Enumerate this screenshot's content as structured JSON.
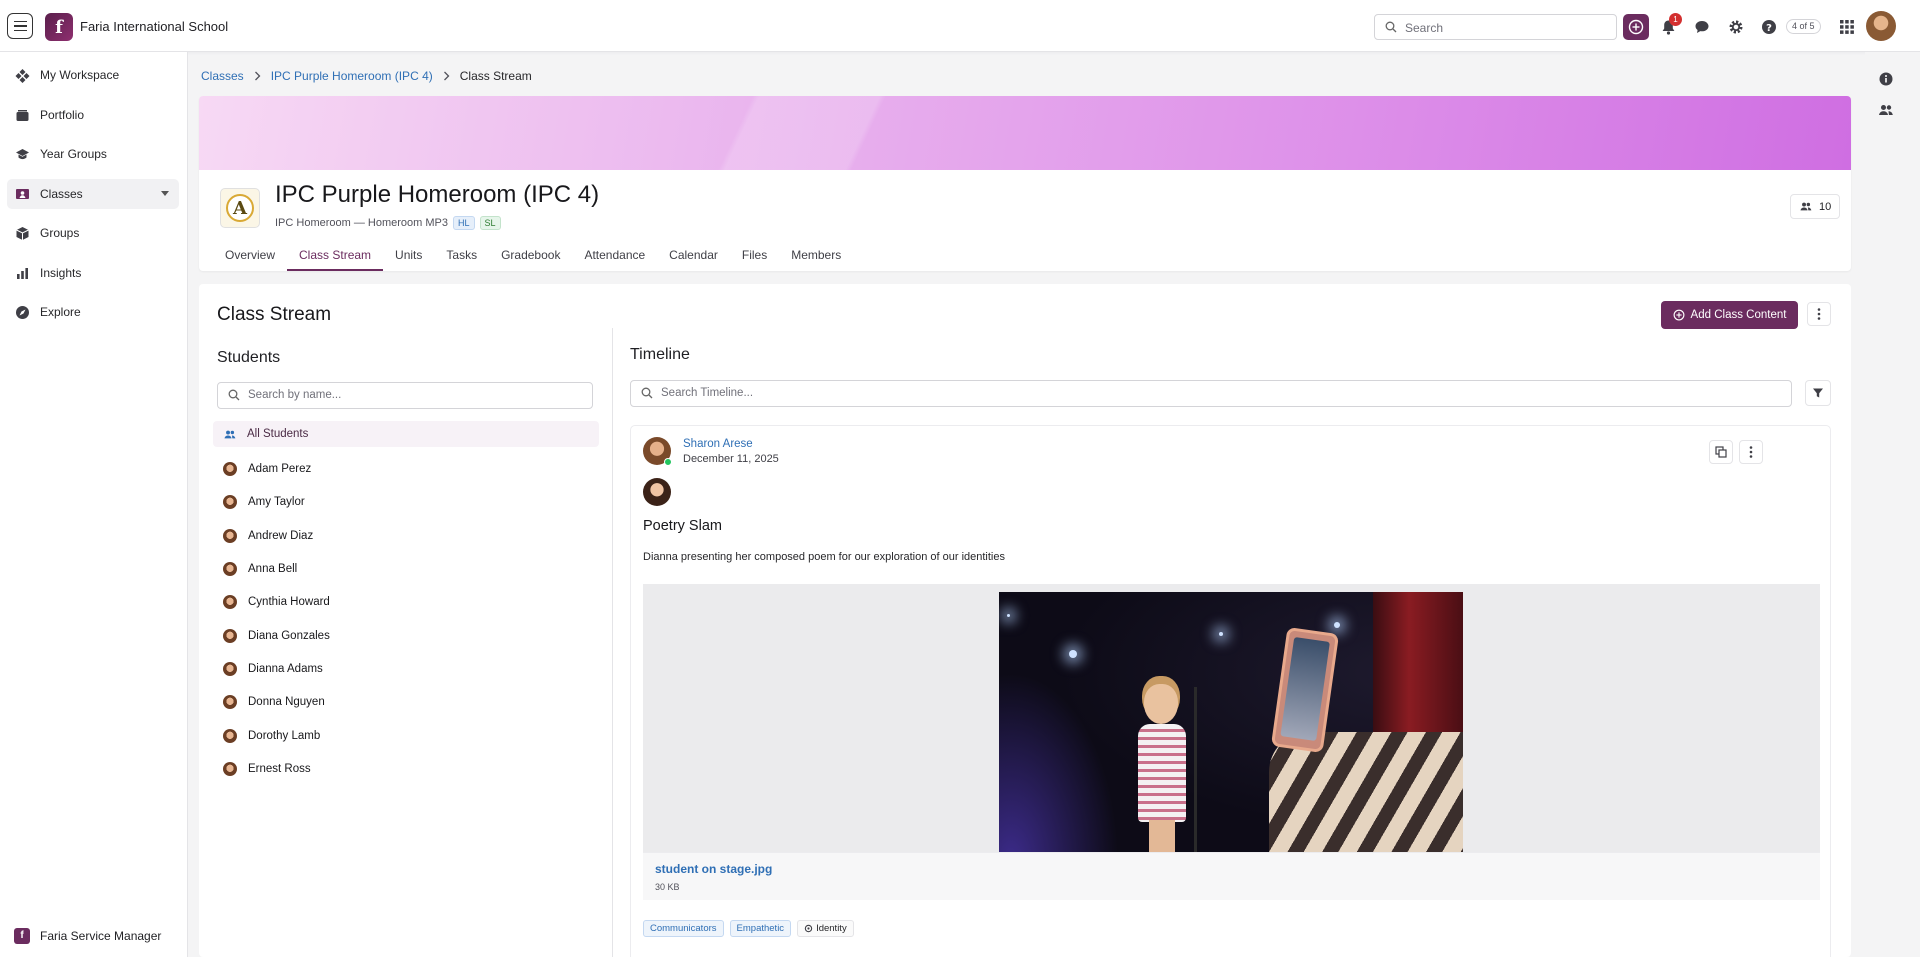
{
  "topbar": {
    "app_name": "Faria International School",
    "logo_letter": "f",
    "search_placeholder": "Search",
    "notification_count": "1",
    "pager": "4 of 5"
  },
  "sidebar": {
    "items": [
      {
        "label": "My Workspace",
        "icon": "workspace-icon"
      },
      {
        "label": "Portfolio",
        "icon": "portfolio-icon"
      },
      {
        "label": "Year Groups",
        "icon": "year-groups-icon"
      },
      {
        "label": "Classes",
        "icon": "classes-icon"
      },
      {
        "label": "Groups",
        "icon": "groups-icon"
      },
      {
        "label": "Insights",
        "icon": "insights-icon"
      },
      {
        "label": "Explore",
        "icon": "explore-icon"
      }
    ],
    "footer_label": "Faria Service Manager"
  },
  "breadcrumb": [
    "Classes",
    "IPC Purple Homeroom (IPC 4)",
    "Class Stream"
  ],
  "class_header": {
    "icon_letter": "A",
    "title": "IPC Purple Homeroom (IPC 4)",
    "subtitle": "IPC Homeroom — Homeroom MP3",
    "tags": [
      "HL",
      "SL"
    ],
    "member_count": "10",
    "tabs": [
      "Overview",
      "Class Stream",
      "Units",
      "Tasks",
      "Gradebook",
      "Attendance",
      "Calendar",
      "Files",
      "Members"
    ],
    "active_tab": "Class Stream"
  },
  "stream": {
    "title": "Class Stream",
    "add_button": "Add Class Content",
    "students_heading": "Students",
    "students_search_placeholder": "Search by name...",
    "all_students_label": "All Students",
    "students": [
      "Adam Perez",
      "Amy Taylor",
      "Andrew Diaz",
      "Anna Bell",
      "Cynthia Howard",
      "Diana Gonzales",
      "Dianna Adams",
      "Donna Nguyen",
      "Dorothy Lamb",
      "Ernest Ross"
    ],
    "timeline_heading": "Timeline",
    "timeline_search_placeholder": "Search Timeline..."
  },
  "post": {
    "author": "Sharon Arese",
    "date": "December 11, 2025",
    "title": "Poetry Slam",
    "description": "Dianna presenting her composed poem for our exploration of our identities",
    "file_name": "student on stage.jpg",
    "file_size": "30 KB",
    "tags": [
      "Communicators",
      "Empathetic"
    ],
    "concept_tag": "Identity"
  },
  "colors": {
    "brand": "#6b2c5f",
    "link": "#2f6fb5",
    "badge": "#d32f2f"
  }
}
